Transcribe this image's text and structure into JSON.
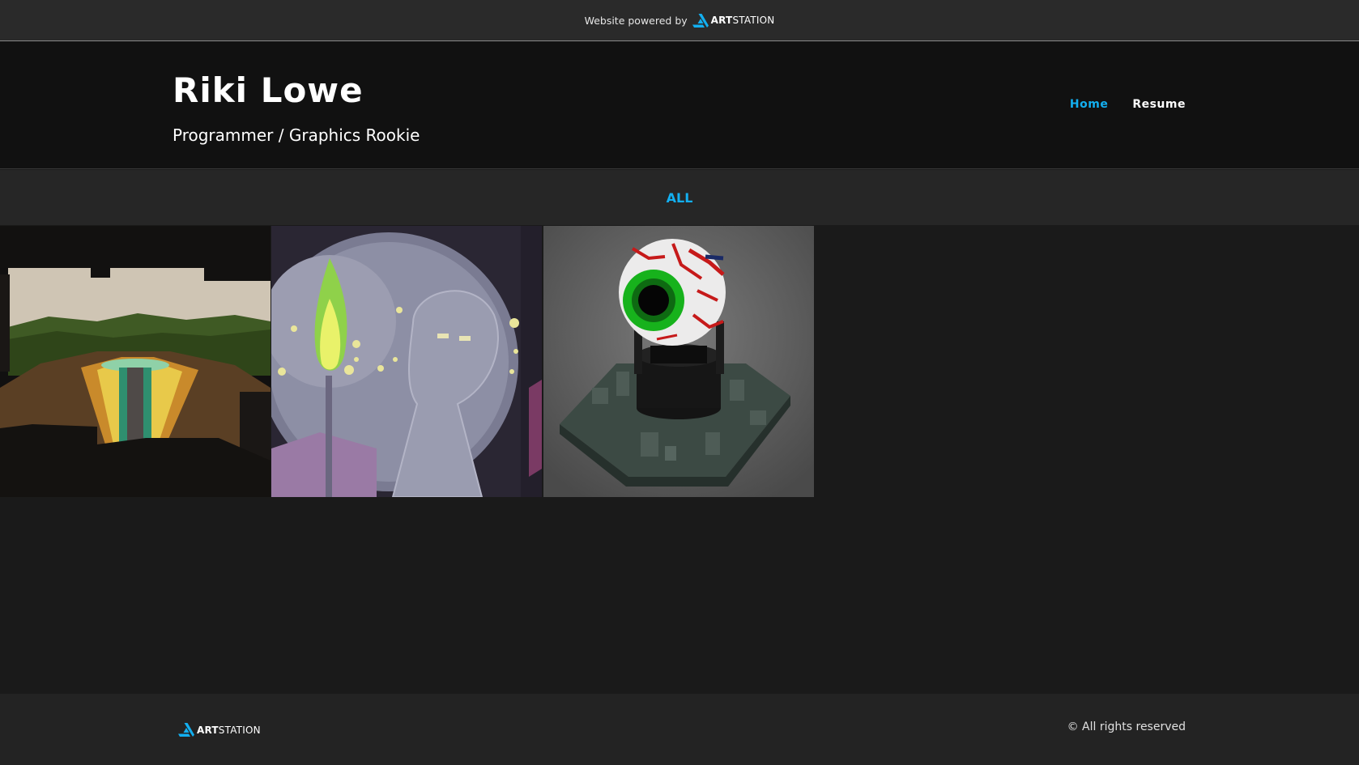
{
  "topbar": {
    "powered_text": "Website powered by",
    "logo_bold": "ART",
    "logo_light": "STATION"
  },
  "header": {
    "title": "Riki Lowe",
    "subtitle": "Programmer / Graphics Rookie",
    "nav": [
      {
        "label": "Home",
        "active": true
      },
      {
        "label": "Resume",
        "active": false
      }
    ]
  },
  "filter": {
    "label": "ALL"
  },
  "gallery": {
    "items": [
      {
        "icon": "voxel-landscape-thumbnail"
      },
      {
        "icon": "pixel-art-ghost-thumbnail"
      },
      {
        "icon": "voxel-eyeball-thumbnail"
      }
    ]
  },
  "footer": {
    "logo_bold": "ART",
    "logo_light": "STATION",
    "rights": "© All rights reserved"
  },
  "colors": {
    "accent": "#13aff0",
    "background": "#1a1a1a",
    "header_bg": "#111111",
    "topbar_bg": "#2a2a2a"
  }
}
